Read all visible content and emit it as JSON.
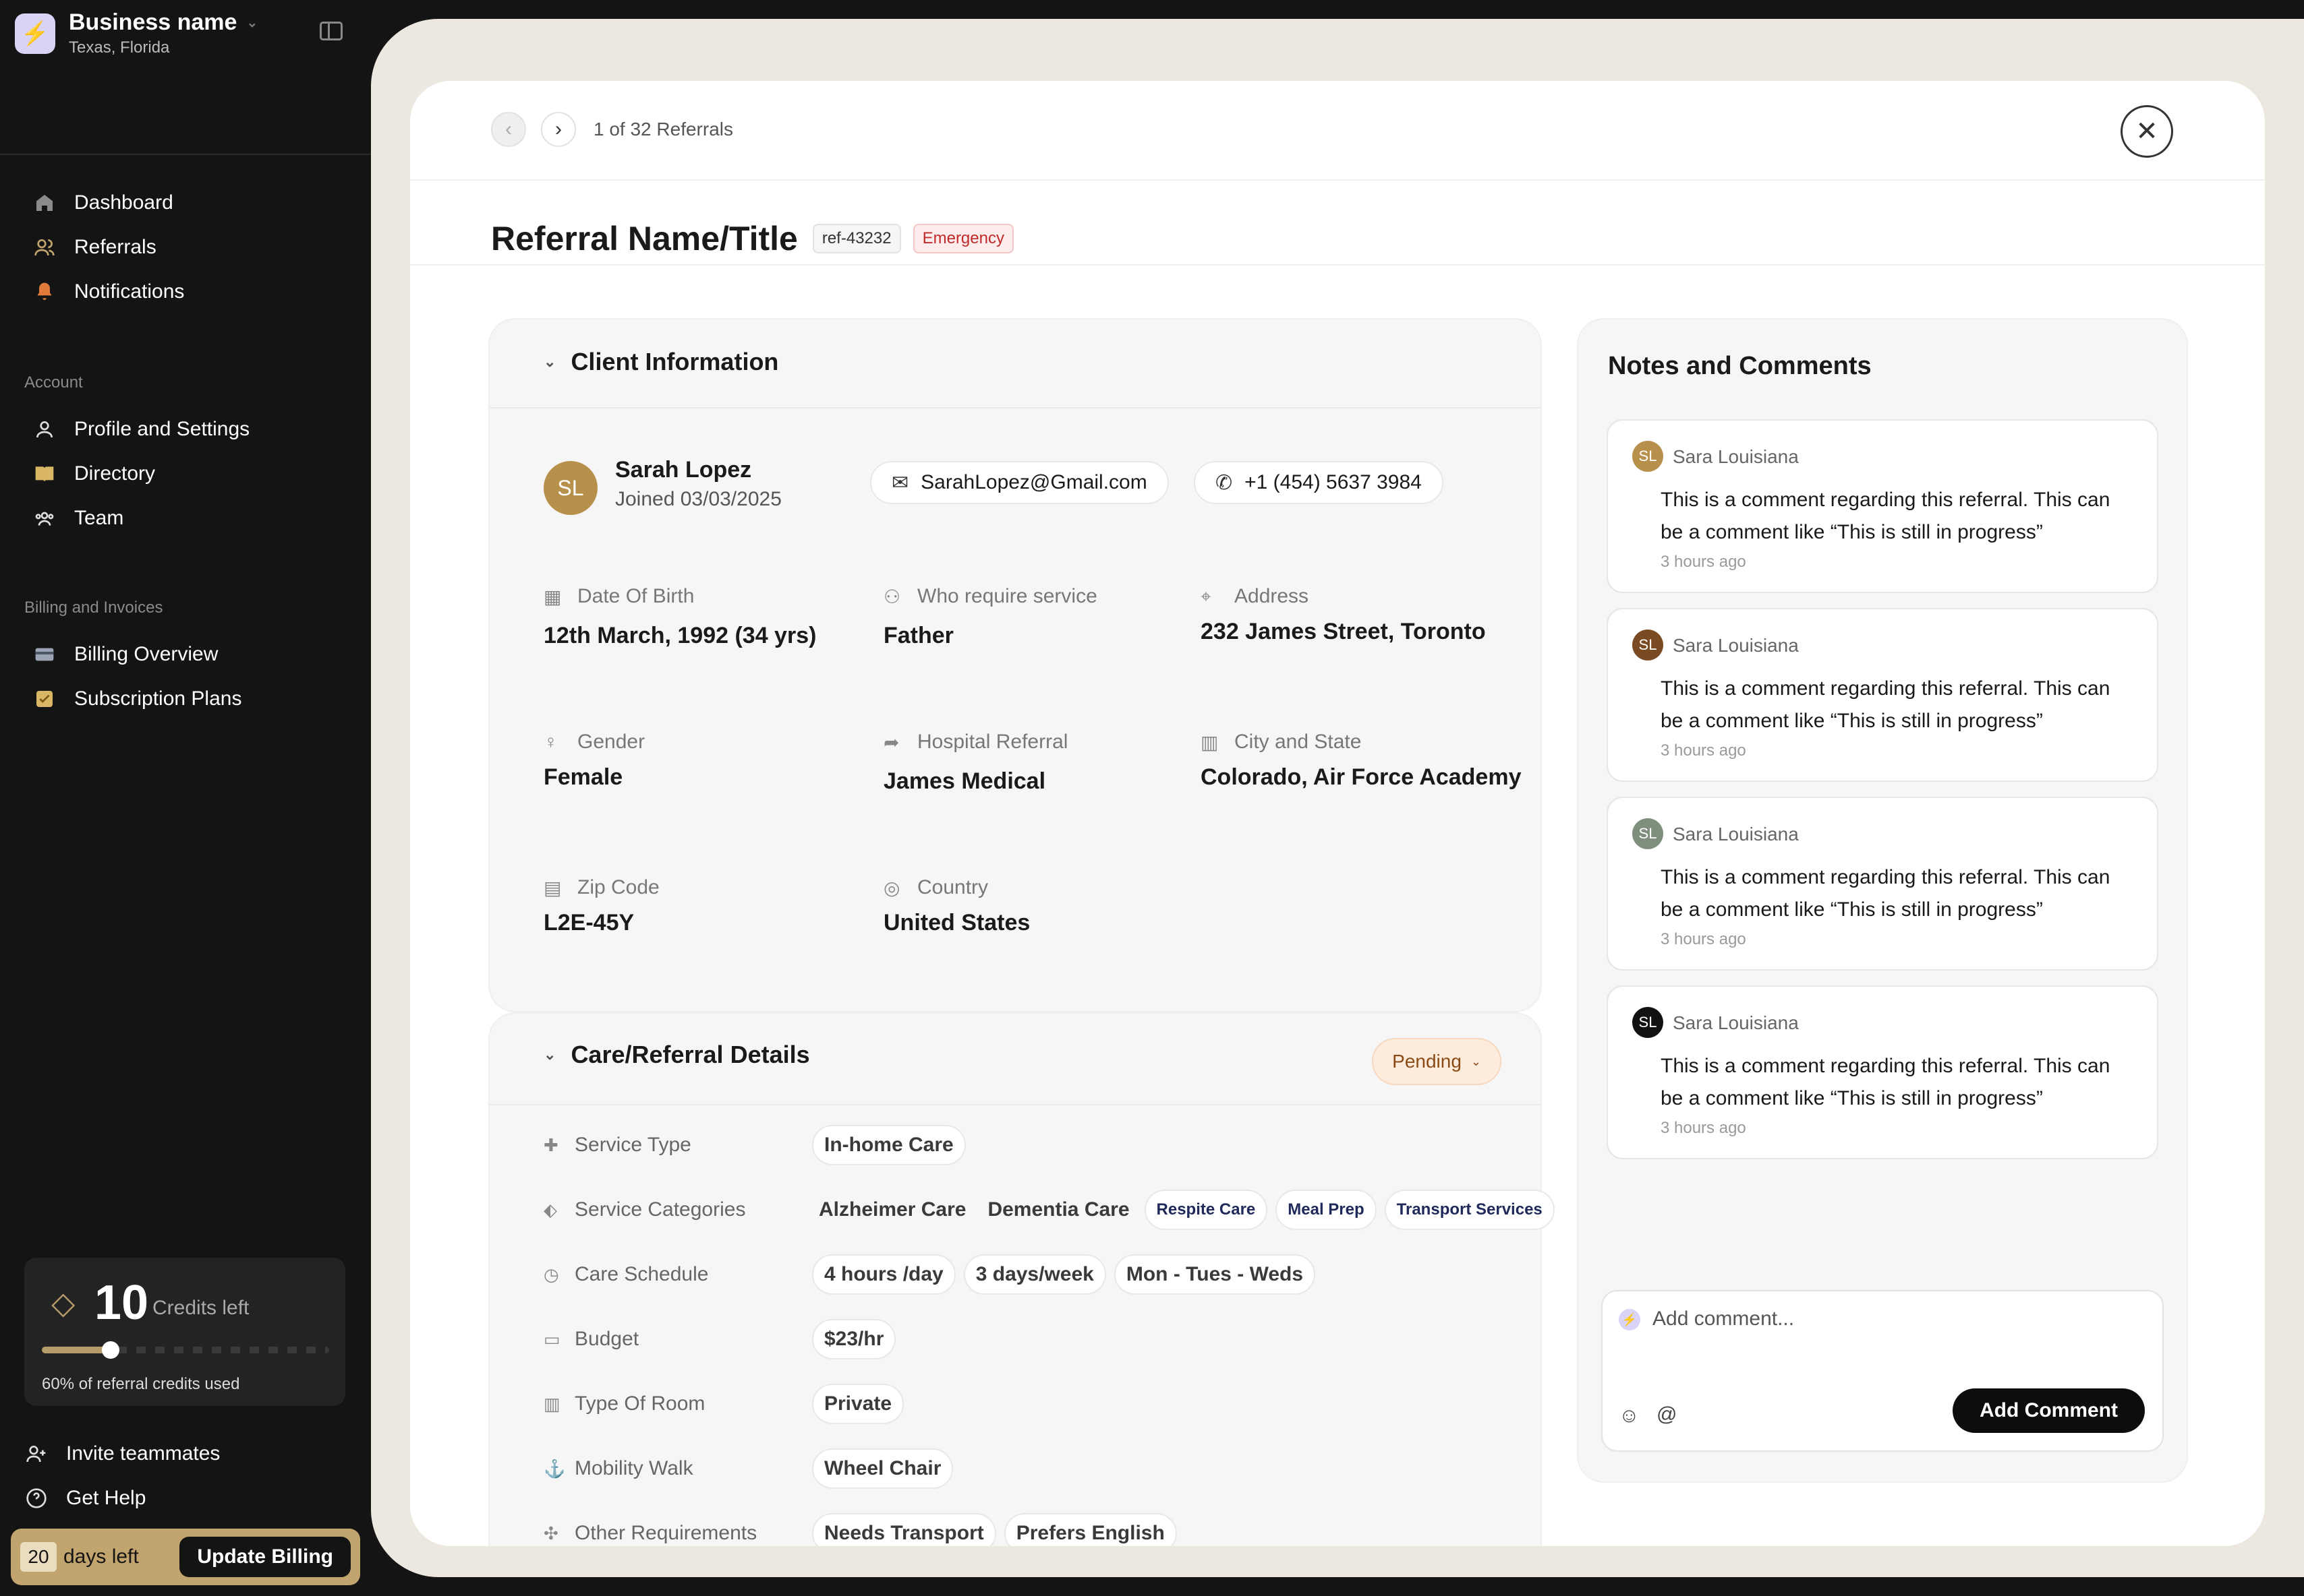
{
  "app": {
    "business_name": "Business name",
    "business_location": "Texas, Florida"
  },
  "sidebar": {
    "main_items": [
      {
        "label": "Dashboard",
        "icon": "house-icon"
      },
      {
        "label": "Referrals",
        "icon": "users-icon"
      },
      {
        "label": "Notifications",
        "icon": "bell-icon"
      }
    ],
    "account_title": "Account",
    "account_items": [
      {
        "label": "Profile and Settings",
        "icon": "person-icon"
      },
      {
        "label": "Directory",
        "icon": "book-icon"
      },
      {
        "label": "Team",
        "icon": "team-icon"
      }
    ],
    "billing_title": "Billing and Invoices",
    "billing_items": [
      {
        "label": "Billing Overview",
        "icon": "card-icon"
      },
      {
        "label": "Subscription Plans",
        "icon": "plan-icon"
      }
    ],
    "credits": {
      "count": "10",
      "label": "Credits left",
      "used_fraction": 0.24,
      "used_text": "60% of referral credits used"
    },
    "bottom_items": [
      {
        "label": "Invite teammates",
        "icon": "add-user-icon"
      },
      {
        "label": "Get Help",
        "icon": "help-icon"
      }
    ],
    "trial": {
      "days": "20",
      "days_label": "days left",
      "update_label": "Update Billing"
    }
  },
  "pager": {
    "text": "1 of 32 Referrals"
  },
  "referral": {
    "title": "Referral Name/Title",
    "ref_id": "ref-43232",
    "priority": "Emergency"
  },
  "client": {
    "section_title": "Client Information",
    "initials": "SL",
    "name": "Sarah Lopez",
    "joined": "Joined  03/03/2025",
    "email": "SarahLopez@Gmail.com",
    "phone": "+1 (454) 5637 3984",
    "fields": {
      "dob": {
        "label": "Date Of Birth",
        "value": "12th March, 1992 (34 yrs)"
      },
      "who": {
        "label": "Who require service",
        "value": "Father"
      },
      "address": {
        "label": "Address",
        "value": "232 James Street, Toronto"
      },
      "gender": {
        "label": "Gender",
        "value": "Female"
      },
      "hospital": {
        "label": "Hospital Referral",
        "value": "James Medical"
      },
      "city": {
        "label": "City and State",
        "value": "Colorado, Air Force Academy"
      },
      "zip": {
        "label": "Zip Code",
        "value": "L2E-45Y"
      },
      "country": {
        "label": "Country",
        "value": "United States"
      }
    }
  },
  "care": {
    "section_title": "Care/Referral Details",
    "status": "Pending",
    "rows": {
      "service_type": {
        "label": "Service Type",
        "tags": [
          "In-home Care"
        ]
      },
      "categories": {
        "label": "Service Categories",
        "tags": [
          "Alzheimer Care",
          "Dementia Care",
          "Respite Care",
          "Meal Prep",
          "Transport Services"
        ]
      },
      "schedule": {
        "label": "Care Schedule",
        "tags": [
          "4 hours /day",
          "3 days/week",
          "Mon - Tues - Weds"
        ]
      },
      "budget": {
        "label": "Budget",
        "tags": [
          "$23/hr"
        ]
      },
      "room": {
        "label": "Type Of Room",
        "tags": [
          "Private"
        ]
      },
      "mobility": {
        "label": "Mobility Walk",
        "tags": [
          "Wheel Chair"
        ]
      },
      "other": {
        "label": "Other Requirements",
        "tags": [
          "Needs Transport",
          "Prefers English"
        ]
      }
    }
  },
  "notes": {
    "title": "Notes and Comments",
    "comments": [
      {
        "initials": "SL",
        "author": "Sara Louisiana",
        "text": "This is a comment regarding this referral. This can be a comment like “This is still in progress”",
        "time": "3 hours ago",
        "color": "#b7914b"
      },
      {
        "initials": "SL",
        "author": "Sara Louisiana",
        "text": "This is a comment regarding this referral. This can be a comment like “This is still in progress”",
        "time": "3 hours ago",
        "color": "#7a4a22"
      },
      {
        "initials": "SL",
        "author": "Sara Louisiana",
        "text": "This is a comment regarding this referral. This can be a comment like “This is still in progress”",
        "time": "3 hours ago",
        "color": "#7f8f7d"
      },
      {
        "initials": "SL",
        "author": "Sara Louisiana",
        "text": "This is a comment regarding this referral. This can be a comment like “This is still in progress”",
        "time": "3 hours ago",
        "color": "#111111"
      }
    ],
    "input_placeholder": "Add comment...",
    "submit_label": "Add Comment"
  },
  "colors": {
    "accent_gold": "#c2a46e",
    "sidebar_bg": "#141414",
    "emergency": "#c02a2a",
    "pending": "#8a4a16"
  }
}
